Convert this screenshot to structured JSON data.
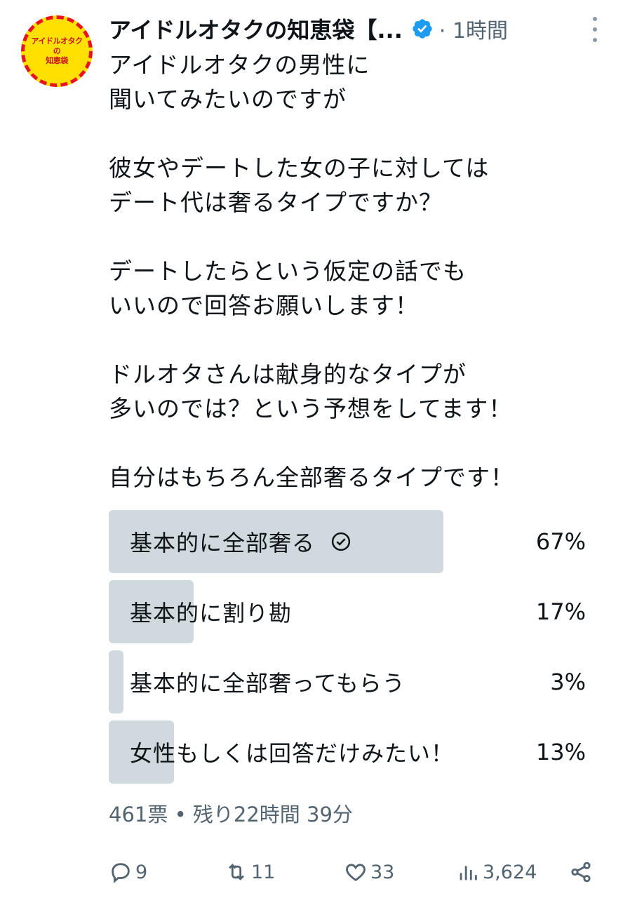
{
  "account": {
    "name": "アイドルオタクの知恵袋【...",
    "time": "· 1時間",
    "avatar_text": [
      "アイドルオタク",
      "の",
      "知恵袋"
    ]
  },
  "tweet": {
    "lines": [
      "アイドルオタクの男性に",
      "聞いてみたいのですが",
      "",
      "彼女やデートした女の子に対しては",
      "デート代は奢るタイプですか？",
      "",
      "デートしたらという仮定の話でも",
      "いいので回答お願いします！",
      "",
      "ドルオタさんは献身的なタイプが",
      "多いのでは？という予想をしてます！",
      "",
      "自分はもちろん全部奢るタイプです！"
    ]
  },
  "poll": {
    "options": [
      {
        "label": "基本的に全部奢る",
        "percent": "67%",
        "share": 0.67,
        "selected": true
      },
      {
        "label": "基本的に割り勘",
        "percent": "17%",
        "share": 0.17,
        "selected": false
      },
      {
        "label": "基本的に全部奢ってもらう",
        "percent": "3%",
        "share": 0.03,
        "selected": false
      },
      {
        "label": "女性もしくは回答だけみたい！",
        "percent": "13%",
        "share": 0.13,
        "selected": false
      }
    ],
    "meta": "461票 • 残り22時間 39分"
  },
  "actions": {
    "replies": "9",
    "reposts": "11",
    "likes": "33",
    "views": "3,624"
  },
  "colors": {
    "verified": "#1d9bf0",
    "poll_fill": "#cfd9de",
    "muted": "#536471",
    "avatar_bg": "#ffe000",
    "avatar_border": "#e8141c"
  }
}
